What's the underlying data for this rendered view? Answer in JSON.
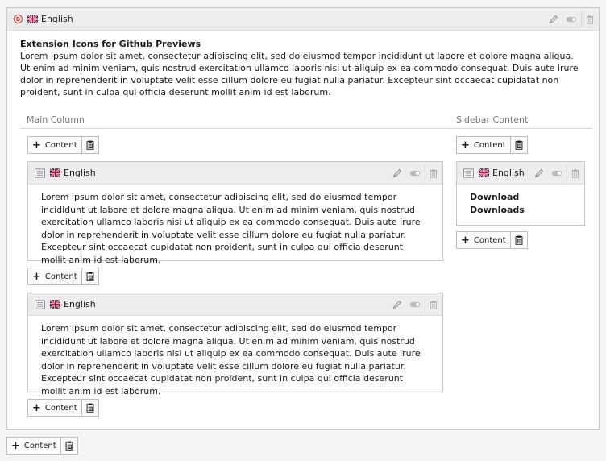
{
  "outer": {
    "badge": "B",
    "language": "English",
    "title": "Extension Icons for Github Previews",
    "text": "Lorem ipsum dolor sit amet, consectetur adipiscing elit, sed do eiusmod tempor incididunt ut labore et dolore magna aliqua. Ut enim ad minim veniam, quis nostrud exercitation ullamco laboris nisi ut aliquip ex ea commodo consequat. Duis aute irure dolor in reprehenderit in voluptate velit esse cillum dolore eu fugiat nulla pariatur. Excepteur sint occaecat cupidatat non proident, sunt in culpa qui officia deserunt mollit anim id est laborum."
  },
  "columns": {
    "main": "Main Column",
    "sidebar": "Sidebar Content"
  },
  "buttons": {
    "content": "Content"
  },
  "main_cards": [
    {
      "language": "English",
      "text": "Lorem ipsum dolor sit amet, consectetur adipiscing elit, sed do eiusmod tempor incididunt ut labore et dolore magna aliqua. Ut enim ad minim veniam, quis nostrud exercitation ullamco laboris nisi ut aliquip ex ea commodo consequat. Duis aute irure dolor in reprehenderit in voluptate velit esse cillum dolore eu fugiat nulla pariatur. Excepteur sint occaecat cupidatat non proident, sunt in culpa qui officia deserunt mollit anim id est laborum."
    },
    {
      "language": "English",
      "text": "Lorem ipsum dolor sit amet, consectetur adipiscing elit, sed do eiusmod tempor incididunt ut labore et dolore magna aliqua. Ut enim ad minim veniam, quis nostrud exercitation ullamco laboris nisi ut aliquip ex ea commodo consequat. Duis aute irure dolor in reprehenderit in voluptate velit esse cillum dolore eu fugiat nulla pariatur. Excepteur sint occaecat cupidatat non proident, sunt in culpa qui officia deserunt mollit anim id est laborum."
    }
  ],
  "sidebar_card": {
    "language": "English",
    "line1": "Download",
    "line2": "Downloads"
  },
  "icons": {
    "edit": "pencil-icon",
    "toggle": "toggle-icon",
    "delete": "trash-icon",
    "paste": "clipboard-icon",
    "flag": "uk-flag-icon"
  },
  "colors": {
    "badge": "#c0392b",
    "header_bg": "#ededed"
  }
}
